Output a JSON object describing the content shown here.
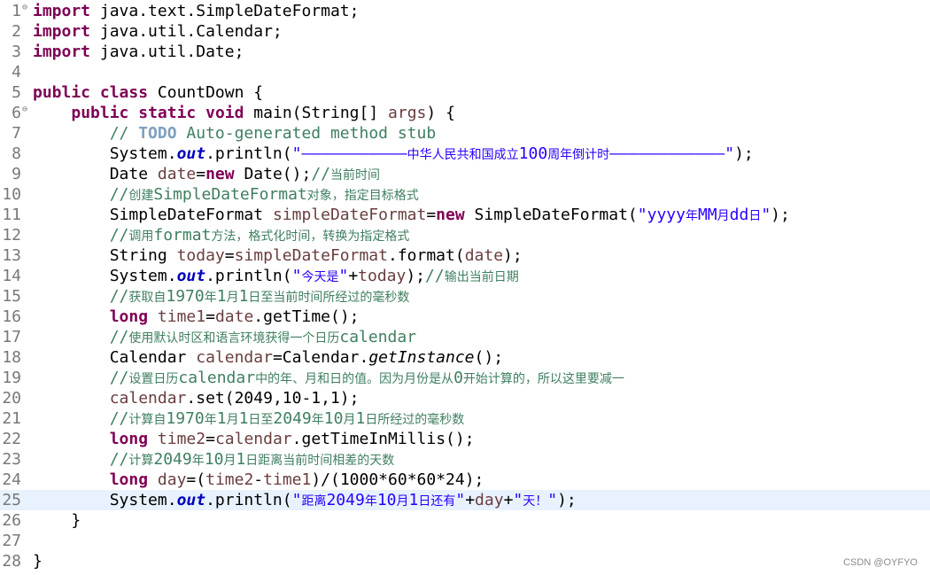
{
  "editor": {
    "current_line": 25,
    "lines": [
      {
        "n": "1",
        "fold": "⊖",
        "tokens": [
          {
            "t": "import",
            "c": "kw"
          },
          {
            "t": " java.text.SimpleDateFormat;"
          }
        ]
      },
      {
        "n": "2",
        "tokens": [
          {
            "t": "import",
            "c": "kw"
          },
          {
            "t": " java.util.Calendar;"
          }
        ]
      },
      {
        "n": "3",
        "tokens": [
          {
            "t": "import",
            "c": "kw"
          },
          {
            "t": " java.util.Date;"
          }
        ]
      },
      {
        "n": "4",
        "tokens": []
      },
      {
        "n": "5",
        "tokens": [
          {
            "t": "public",
            "c": "kw"
          },
          {
            "t": " "
          },
          {
            "t": "class",
            "c": "kw"
          },
          {
            "t": " CountDown {"
          }
        ]
      },
      {
        "n": "6",
        "fold": "⊖",
        "tokens": [
          {
            "t": "    "
          },
          {
            "t": "public",
            "c": "kw"
          },
          {
            "t": " "
          },
          {
            "t": "static",
            "c": "kw"
          },
          {
            "t": " "
          },
          {
            "t": "void",
            "c": "kw"
          },
          {
            "t": " main(String[] "
          },
          {
            "t": "args",
            "c": "var"
          },
          {
            "t": ") {"
          }
        ]
      },
      {
        "n": "7",
        "tokens": [
          {
            "t": "        // ",
            "c": "cm"
          },
          {
            "t": "TODO",
            "c": "todo"
          },
          {
            "t": " Auto-generated method stub",
            "c": "cm"
          }
        ]
      },
      {
        "n": "8",
        "tokens": [
          {
            "t": "        System."
          },
          {
            "t": "out",
            "c": "fld"
          },
          {
            "t": ".println("
          },
          {
            "t": "\"———————————",
            "c": "str"
          },
          {
            "t": "中华人民共和国成立",
            "c": "str cjk"
          },
          {
            "t": "100",
            "c": "str"
          },
          {
            "t": "周年倒计时",
            "c": "str cjk"
          },
          {
            "t": "————————————\"",
            "c": "str"
          },
          {
            "t": ");"
          }
        ]
      },
      {
        "n": "9",
        "tokens": [
          {
            "t": "        Date "
          },
          {
            "t": "date",
            "c": "var"
          },
          {
            "t": "="
          },
          {
            "t": "new",
            "c": "kw"
          },
          {
            "t": " Date();"
          },
          {
            "t": "//",
            "c": "cm"
          },
          {
            "t": "当前时间",
            "c": "cm cjk"
          }
        ]
      },
      {
        "n": "10",
        "tokens": [
          {
            "t": "        //",
            "c": "cm"
          },
          {
            "t": "创建",
            "c": "cm cjk"
          },
          {
            "t": "SimpleDateFormat",
            "c": "cm"
          },
          {
            "t": "对象，指定目标格式",
            "c": "cm cjk"
          }
        ]
      },
      {
        "n": "11",
        "tokens": [
          {
            "t": "        SimpleDateFormat "
          },
          {
            "t": "simpleDateFormat",
            "c": "var"
          },
          {
            "t": "="
          },
          {
            "t": "new",
            "c": "kw"
          },
          {
            "t": " SimpleDateFormat("
          },
          {
            "t": "\"yyyy",
            "c": "str"
          },
          {
            "t": "年",
            "c": "str cjk"
          },
          {
            "t": "MM",
            "c": "str"
          },
          {
            "t": "月",
            "c": "str cjk"
          },
          {
            "t": "dd",
            "c": "str"
          },
          {
            "t": "日",
            "c": "str cjk"
          },
          {
            "t": "\"",
            "c": "str"
          },
          {
            "t": ");"
          }
        ]
      },
      {
        "n": "12",
        "tokens": [
          {
            "t": "        //",
            "c": "cm"
          },
          {
            "t": "调用",
            "c": "cm cjk"
          },
          {
            "t": "format",
            "c": "cm"
          },
          {
            "t": "方法，格式化时间，转换为指定格式",
            "c": "cm cjk"
          }
        ]
      },
      {
        "n": "13",
        "tokens": [
          {
            "t": "        String "
          },
          {
            "t": "today",
            "c": "var"
          },
          {
            "t": "="
          },
          {
            "t": "simpleDateFormat",
            "c": "var"
          },
          {
            "t": ".format("
          },
          {
            "t": "date",
            "c": "var"
          },
          {
            "t": ");"
          }
        ]
      },
      {
        "n": "14",
        "tokens": [
          {
            "t": "        System."
          },
          {
            "t": "out",
            "c": "fld"
          },
          {
            "t": ".println("
          },
          {
            "t": "\"",
            "c": "str"
          },
          {
            "t": "今天是",
            "c": "str cjk"
          },
          {
            "t": "\"",
            "c": "str"
          },
          {
            "t": "+"
          },
          {
            "t": "today",
            "c": "var"
          },
          {
            "t": ");"
          },
          {
            "t": "//",
            "c": "cm"
          },
          {
            "t": "输出当前日期",
            "c": "cm cjk"
          }
        ]
      },
      {
        "n": "15",
        "tokens": [
          {
            "t": "        //",
            "c": "cm"
          },
          {
            "t": "获取自",
            "c": "cm cjk"
          },
          {
            "t": "1970",
            "c": "cm"
          },
          {
            "t": "年",
            "c": "cm cjk"
          },
          {
            "t": "1",
            "c": "cm"
          },
          {
            "t": "月",
            "c": "cm cjk"
          },
          {
            "t": "1",
            "c": "cm"
          },
          {
            "t": "日至当前时间所经过的毫秒数",
            "c": "cm cjk"
          }
        ]
      },
      {
        "n": "16",
        "tokens": [
          {
            "t": "        "
          },
          {
            "t": "long",
            "c": "kw"
          },
          {
            "t": " "
          },
          {
            "t": "time1",
            "c": "var"
          },
          {
            "t": "="
          },
          {
            "t": "date",
            "c": "var"
          },
          {
            "t": ".getTime();"
          }
        ]
      },
      {
        "n": "17",
        "tokens": [
          {
            "t": "        //",
            "c": "cm"
          },
          {
            "t": "使用默认时区和语言环境获得一个日历",
            "c": "cm cjk"
          },
          {
            "t": "calendar",
            "c": "cm"
          }
        ]
      },
      {
        "n": "18",
        "tokens": [
          {
            "t": "        Calendar "
          },
          {
            "t": "calendar",
            "c": "var"
          },
          {
            "t": "=Calendar."
          },
          {
            "t": "getInstance",
            "c": "ital"
          },
          {
            "t": "();"
          }
        ]
      },
      {
        "n": "19",
        "tokens": [
          {
            "t": "        //",
            "c": "cm"
          },
          {
            "t": "设置日历",
            "c": "cm cjk"
          },
          {
            "t": "calendar",
            "c": "cm"
          },
          {
            "t": "中的年、月和日的值。因为月份是从",
            "c": "cm cjk"
          },
          {
            "t": "0",
            "c": "cm"
          },
          {
            "t": "开始计算的，所以这里要减一",
            "c": "cm cjk"
          }
        ]
      },
      {
        "n": "20",
        "tokens": [
          {
            "t": "        "
          },
          {
            "t": "calendar",
            "c": "var"
          },
          {
            "t": ".set(2049,10-1,1);"
          }
        ]
      },
      {
        "n": "21",
        "tokens": [
          {
            "t": "        //",
            "c": "cm"
          },
          {
            "t": "计算自",
            "c": "cm cjk"
          },
          {
            "t": "1970",
            "c": "cm"
          },
          {
            "t": "年",
            "c": "cm cjk"
          },
          {
            "t": "1",
            "c": "cm"
          },
          {
            "t": "月",
            "c": "cm cjk"
          },
          {
            "t": "1",
            "c": "cm"
          },
          {
            "t": "日至",
            "c": "cm cjk"
          },
          {
            "t": "2049",
            "c": "cm"
          },
          {
            "t": "年",
            "c": "cm cjk"
          },
          {
            "t": "10",
            "c": "cm"
          },
          {
            "t": "月",
            "c": "cm cjk"
          },
          {
            "t": "1",
            "c": "cm"
          },
          {
            "t": "日所经过的毫秒数",
            "c": "cm cjk"
          }
        ]
      },
      {
        "n": "22",
        "tokens": [
          {
            "t": "        "
          },
          {
            "t": "long",
            "c": "kw"
          },
          {
            "t": " "
          },
          {
            "t": "time2",
            "c": "var"
          },
          {
            "t": "="
          },
          {
            "t": "calendar",
            "c": "var"
          },
          {
            "t": ".getTimeInMillis();"
          }
        ]
      },
      {
        "n": "23",
        "tokens": [
          {
            "t": "        //",
            "c": "cm"
          },
          {
            "t": "计算",
            "c": "cm cjk"
          },
          {
            "t": "2049",
            "c": "cm"
          },
          {
            "t": "年",
            "c": "cm cjk"
          },
          {
            "t": "10",
            "c": "cm"
          },
          {
            "t": "月",
            "c": "cm cjk"
          },
          {
            "t": "1",
            "c": "cm"
          },
          {
            "t": "日距离当前时间相差的天数",
            "c": "cm cjk"
          }
        ]
      },
      {
        "n": "24",
        "tokens": [
          {
            "t": "        "
          },
          {
            "t": "long",
            "c": "kw"
          },
          {
            "t": " "
          },
          {
            "t": "day",
            "c": "var"
          },
          {
            "t": "=("
          },
          {
            "t": "time2",
            "c": "var"
          },
          {
            "t": "-"
          },
          {
            "t": "time1",
            "c": "var"
          },
          {
            "t": ")/(1000*60*60*24);"
          }
        ]
      },
      {
        "n": "25",
        "tokens": [
          {
            "t": "        System."
          },
          {
            "t": "out",
            "c": "fld"
          },
          {
            "t": ".println("
          },
          {
            "t": "\"",
            "c": "str"
          },
          {
            "t": "距离",
            "c": "str cjk"
          },
          {
            "t": "2049",
            "c": "str"
          },
          {
            "t": "年",
            "c": "str cjk"
          },
          {
            "t": "10",
            "c": "str"
          },
          {
            "t": "月",
            "c": "str cjk"
          },
          {
            "t": "1",
            "c": "str"
          },
          {
            "t": "日还有",
            "c": "str cjk"
          },
          {
            "t": "\"",
            "c": "str"
          },
          {
            "t": "+"
          },
          {
            "t": "day",
            "c": "var"
          },
          {
            "t": "+"
          },
          {
            "t": "\"",
            "c": "str"
          },
          {
            "t": "天！",
            "c": "str cjk"
          },
          {
            "t": "\"",
            "c": "str"
          },
          {
            "t": ");"
          }
        ]
      },
      {
        "n": "26",
        "tokens": [
          {
            "t": "    }"
          }
        ]
      },
      {
        "n": "27",
        "tokens": []
      },
      {
        "n": "28",
        "tokens": [
          {
            "t": "}"
          }
        ]
      }
    ]
  },
  "watermark": "CSDN @OYFYO"
}
